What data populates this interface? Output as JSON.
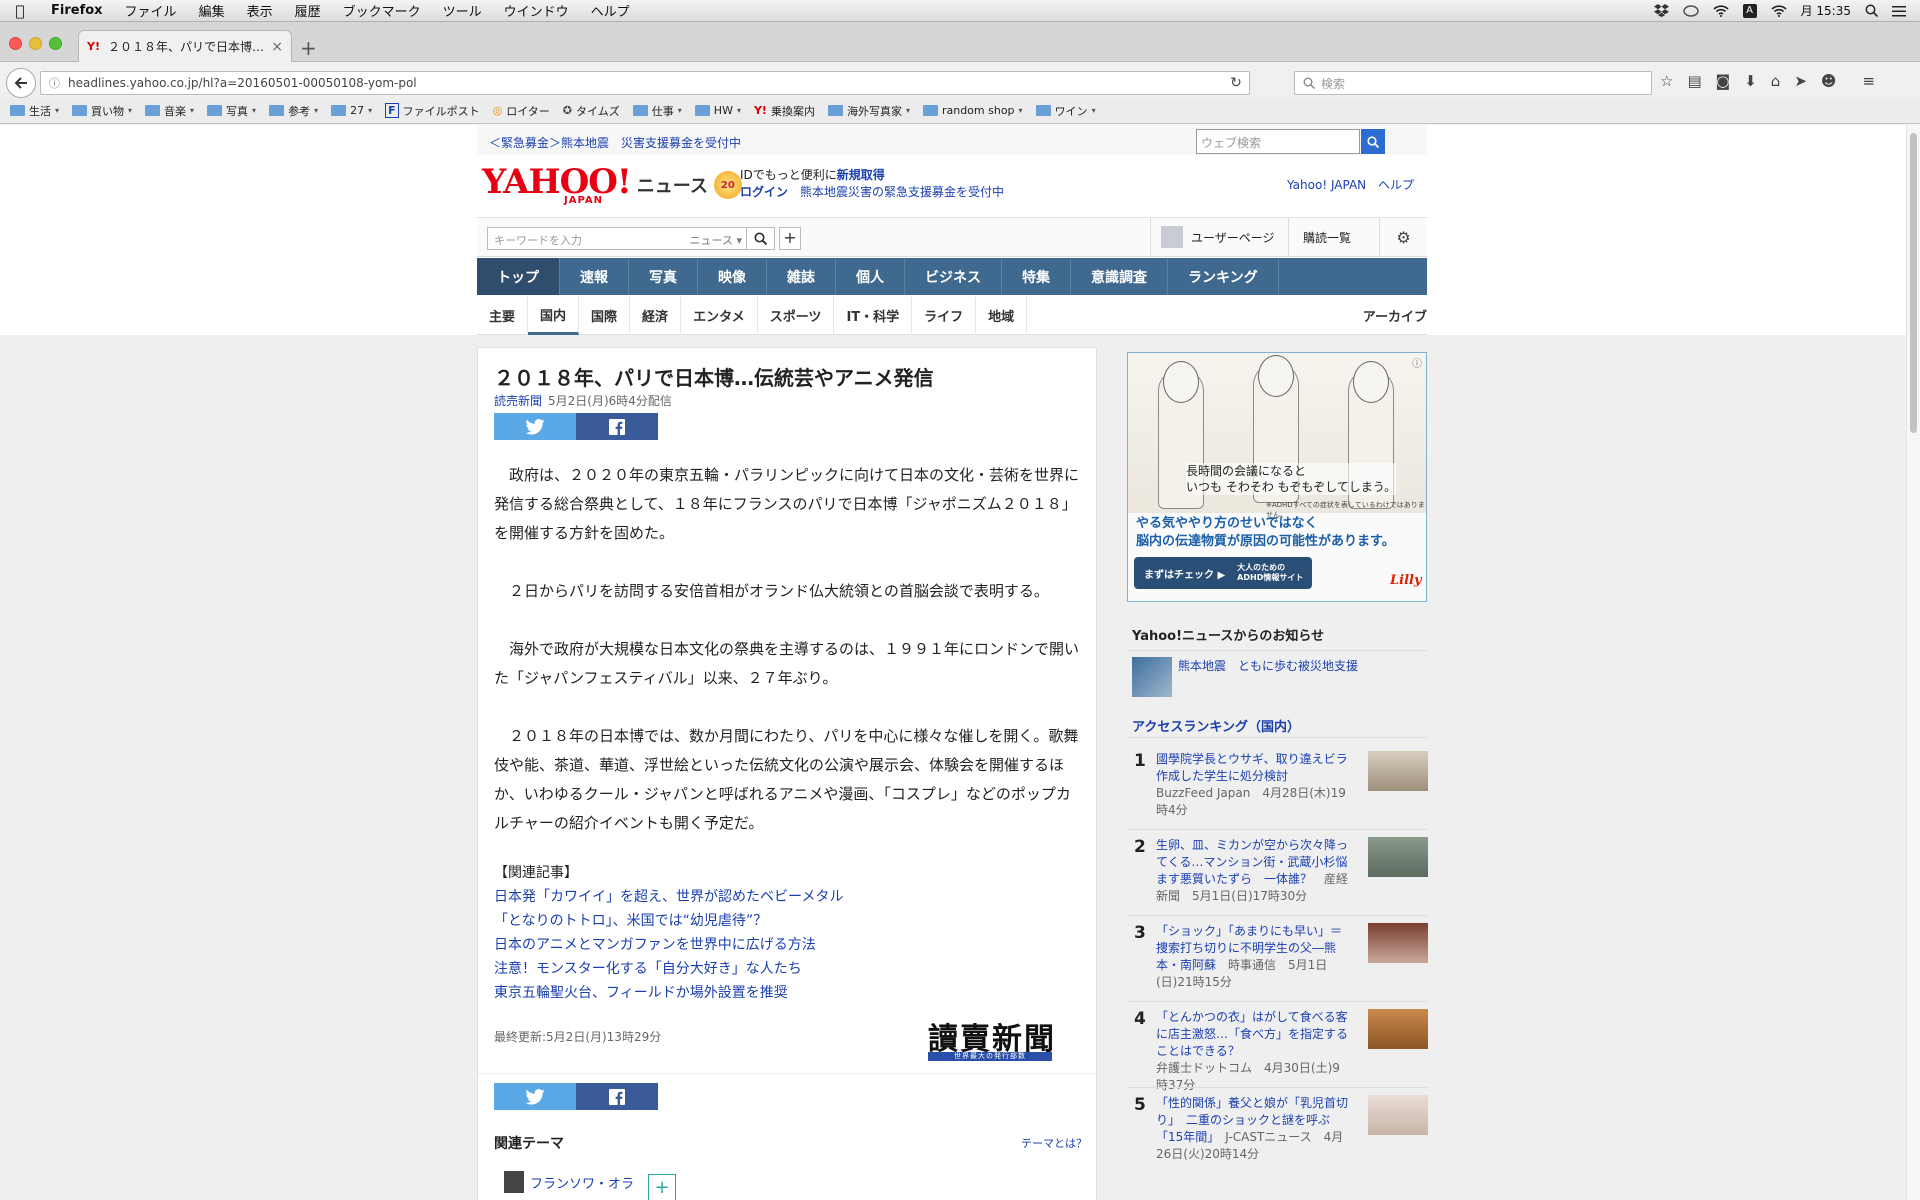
{
  "menubar": {
    "app": "Firefox",
    "items": [
      "ファイル",
      "編集",
      "表示",
      "履歴",
      "ブックマーク",
      "ツール",
      "ウインドウ",
      "ヘルプ"
    ],
    "clock": "月 15:35"
  },
  "tab": {
    "title": "２０１８年、パリで日本博…",
    "favicon": "Y!"
  },
  "navbar": {
    "url": "headlines.yahoo.co.jp/hl?a=20160501-00050108-yom-pol",
    "search_placeholder": "検索"
  },
  "bookmarks": [
    {
      "label": "生活",
      "type": "folder"
    },
    {
      "label": "買い物",
      "type": "folder"
    },
    {
      "label": "音楽",
      "type": "folder"
    },
    {
      "label": "写真",
      "type": "folder"
    },
    {
      "label": "参考",
      "type": "folder"
    },
    {
      "label": "27",
      "type": "folder"
    },
    {
      "label": "ファイルポスト",
      "type": "link",
      "glyph": "F"
    },
    {
      "label": "ロイター",
      "type": "link",
      "glyph": "◎"
    },
    {
      "label": "タイムズ",
      "type": "link",
      "glyph": "✪"
    },
    {
      "label": "仕事",
      "type": "folder"
    },
    {
      "label": "HW",
      "type": "folder"
    },
    {
      "label": "乗換案内",
      "type": "link",
      "glyph": "Y!"
    },
    {
      "label": "海外写真家",
      "type": "folder"
    },
    {
      "label": "random shop",
      "type": "folder"
    },
    {
      "label": "ワイン",
      "type": "folder"
    }
  ],
  "header": {
    "emergency": "＜緊急募金＞熊本地震　災害支援募金を受付中",
    "web_search_placeholder": "ウェブ検索",
    "logo": "YAHOO!",
    "logo_sub": "JAPAN",
    "section": "ニュース",
    "badge": "20",
    "promo_line1_pre": "IDでもっと便利に",
    "promo_line1_link": "新規取得",
    "promo_line2_link": "ログイン",
    "promo_line2_text": "熊本地震災害の緊急支援募金を受付中",
    "yj_link": "Yahoo! JAPAN",
    "help_link": "ヘルプ",
    "keyword_placeholder": "キーワードを入力",
    "keyword_category": "ニュース",
    "user_page": "ユーザーページ",
    "subscriptions": "購読一覧"
  },
  "mainnav": [
    "トップ",
    "速報",
    "写真",
    "映像",
    "雑誌",
    "個人",
    "ビジネス",
    "特集",
    "意識調査",
    "ランキング"
  ],
  "subnav": [
    "主要",
    "国内",
    "国際",
    "経済",
    "エンタメ",
    "スポーツ",
    "IT・科学",
    "ライフ",
    "地域"
  ],
  "subnav_archive": "アーカイブ",
  "article": {
    "title": "２０１８年、パリで日本博…伝統芸やアニメ発信",
    "source": "読売新聞",
    "date": "5月2日(月)6時4分配信",
    "paragraphs": [
      "政府は、２０２０年の東京五輪・パラリンピックに向けて日本の文化・芸術を世界に発信する総合祭典として、１８年にフランスのパリで日本博「ジャポニズム２０１８」を開催する方針を固めた。",
      "２日からパリを訪問する安倍首相がオランド仏大統領との首脳会談で表明する。",
      "海外で政府が大規模な日本文化の祭典を主導するのは、１９９１年にロンドンで開いた「ジャパンフェスティバル」以来、２７年ぶり。",
      "２０１８年の日本博では、数か月間にわたり、パリを中心に様々な催しを開く。歌舞伎や能、茶道、華道、浮世絵といった伝統文化の公演や展示会、体験会を開催するほか、いわゆるクール・ジャパンと呼ばれるアニメや漫画、「コスプレ」などのポップカルチャーの紹介イベントも開く予定だ。"
    ],
    "related_heading": "【関連記事】",
    "related": [
      "日本発「カワイイ」を超え、世界が認めたベビーメタル",
      "「となりのトトロ」、米国では“幼児虐待”？",
      "日本のアニメとマンガファンを世界中に広げる方法",
      "注意！モンスター化する「自分大好き」な人たち",
      "東京五輪聖火台、フィールドか場外設置を推奨"
    ],
    "updated": "最終更新:5月2日(月)13時29分",
    "publisher_logo": "讀賣新聞",
    "publisher_tagline": "世界最大の発行部数",
    "theme_heading": "関連テーマ",
    "theme_what": "テーマとは？",
    "theme_item": "フランソワ・オラ"
  },
  "ad": {
    "caption": "長時間の会議になると\nいつも そわそわ もぞもぞしてしまう。",
    "fine": "※ADHDすべての症状を表しているわけではありません。",
    "headline": "やる気ややり方のせいではなく\n脳内の伝達物質が原因の可能性があります。",
    "cta": "まずはチェック ▶",
    "cta_right": "大人のための\nADHD情報サイト",
    "brand": "Lilly",
    "info": "ⓘ"
  },
  "sidebar": {
    "notice_heading": "Yahoo!ニュースからのお知らせ",
    "notice_item": "熊本地震　ともに歩む被災地支援",
    "ranking_heading": "アクセスランキング（国内）",
    "ranking": [
      {
        "num": "1",
        "title": "國學院学長とウサギ、取り違えビラ　作成した学生に処分検討",
        "meta": "BuzzFeed Japan　4月28日(木)19時4分"
      },
      {
        "num": "2",
        "title": "生卵、皿、ミカンが空から次々降ってくる…マンション街・武蔵小杉悩ます悪質いたずら　一体誰？",
        "meta": "産経新聞　5月1日(日)17時30分"
      },
      {
        "num": "3",
        "title": "「ショック」「あまりにも早い」＝捜索打ち切りに不明学生の父―熊本・南阿蘇",
        "meta": "時事通信　5月1日(日)21時15分"
      },
      {
        "num": "4",
        "title": "「とんかつの衣」はがして食べる客に店主激怒…「食べ方」を指定することはできる？",
        "meta": "弁護士ドットコム　4月30日(土)9時37分"
      },
      {
        "num": "5",
        "title": "「性的関係」養父と娘が「乳児首切り」　二重のショックと謎を呼ぶ「15年間」",
        "meta": "J-CASTニュース　4月26日(火)20時14分"
      }
    ]
  }
}
